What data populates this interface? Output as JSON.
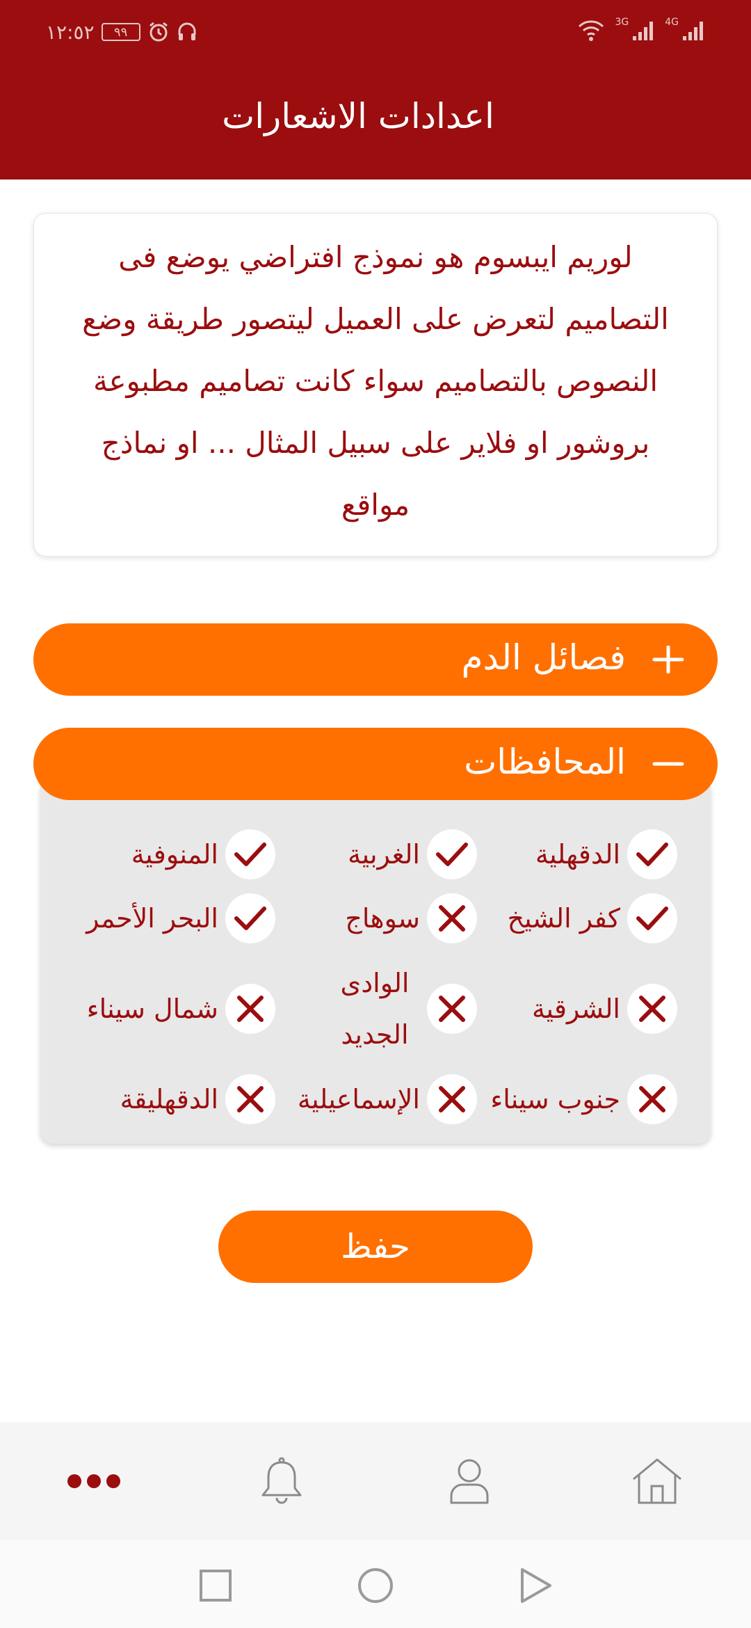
{
  "status_bar": {
    "time": "١٢:٥٢",
    "battery": "٩٩",
    "signal_1": "3G",
    "signal_2": "4G"
  },
  "header": {
    "title": "اعدادات الاشعارات"
  },
  "intro": {
    "text": "لوريم ايبسوم هو نموذج افتراضي يوضع فى التصاميم لتعرض على العميل ليتصور طريقة وضع النصوص بالتصاميم سواء كانت تصاميم مطبوعة بروشور او فلاير على سبيل المثال ... او نماذج مواقع"
  },
  "accordions": {
    "blood_types": {
      "label": "فصائل الدم",
      "expanded": false
    },
    "governorates": {
      "label": "المحافظات",
      "expanded": true
    }
  },
  "governorates": [
    {
      "name": "الدقهلية",
      "checked": true
    },
    {
      "name": "الغربية",
      "checked": true
    },
    {
      "name": "المنوفية",
      "checked": true
    },
    {
      "name": "كفر الشيخ",
      "checked": true
    },
    {
      "name": "سوهاج",
      "checked": false
    },
    {
      "name": "البحر الأحمر",
      "checked": true
    },
    {
      "name": "الشرقية",
      "checked": false
    },
    {
      "name": "الوادى الجديد",
      "checked": false
    },
    {
      "name": "شمال سيناء",
      "checked": false
    },
    {
      "name": "جنوب سيناء",
      "checked": false
    },
    {
      "name": "الإسماعيلية",
      "checked": false
    },
    {
      "name": "الدقهليقة",
      "checked": false
    }
  ],
  "actions": {
    "save_label": "حفظ"
  },
  "bottom_nav": {
    "items": [
      {
        "icon": "home-icon",
        "active": false
      },
      {
        "icon": "profile-icon",
        "active": false
      },
      {
        "icon": "bell-icon",
        "active": false
      },
      {
        "icon": "more-icon",
        "active": true
      }
    ]
  },
  "colors": {
    "primary": "#9b0d0e",
    "accent": "#ff7000",
    "panel": "#e8e8e8",
    "nav_icon": "#888888"
  }
}
